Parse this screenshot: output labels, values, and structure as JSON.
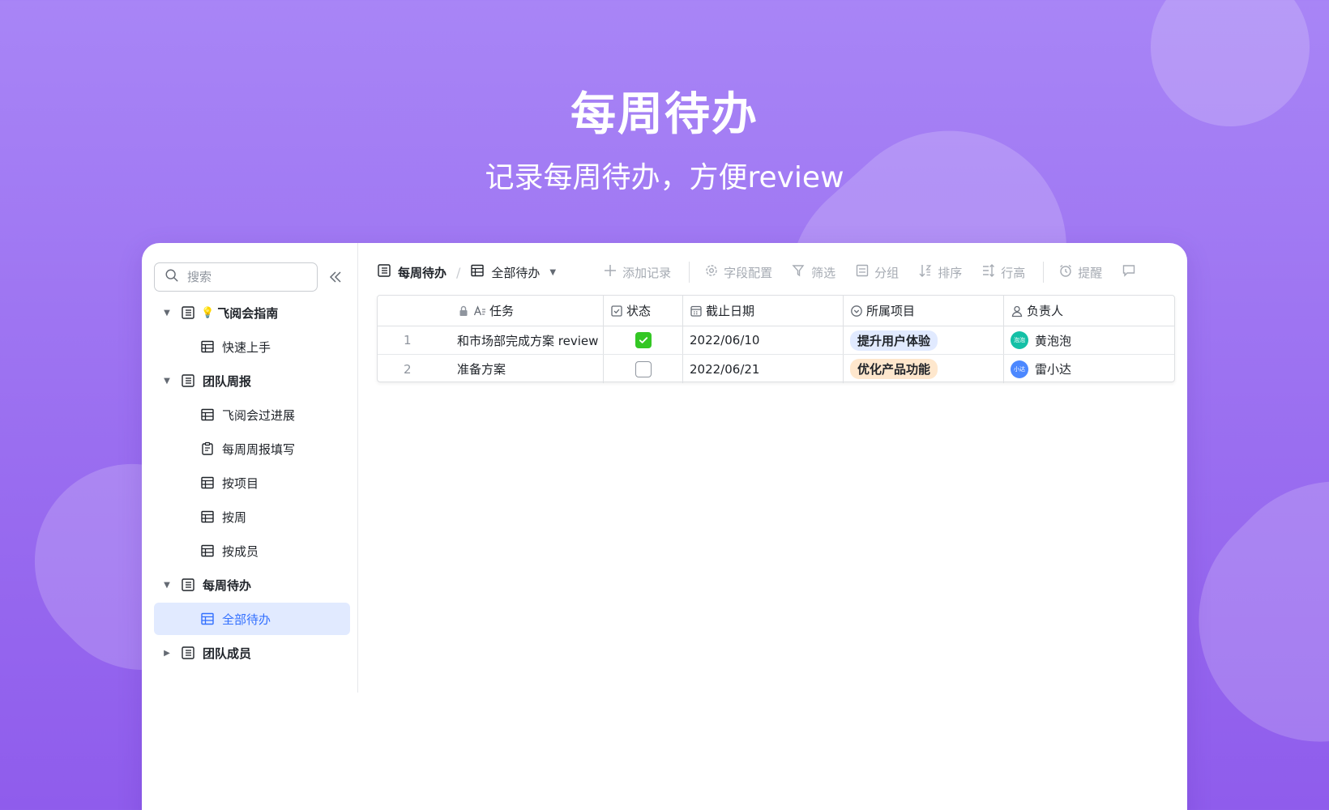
{
  "hero": {
    "title": "每周待办",
    "subtitle": "记录每周待办，方便review"
  },
  "sidebar": {
    "search_placeholder": "搜索",
    "items": [
      {
        "label": "飞阅会指南",
        "level": 0,
        "icon": "doc-icon",
        "expanded": true
      },
      {
        "label": "快速上手",
        "level": 1,
        "icon": "table-icon"
      },
      {
        "label": "团队周报",
        "level": 0,
        "icon": "doc-icon",
        "expanded": true
      },
      {
        "label": "飞阅会过进展",
        "level": 1,
        "icon": "table-icon"
      },
      {
        "label": "每周周报填写",
        "level": 1,
        "icon": "form-icon"
      },
      {
        "label": "按项目",
        "level": 1,
        "icon": "table-icon"
      },
      {
        "label": "按周",
        "level": 1,
        "icon": "table-icon"
      },
      {
        "label": "按成员",
        "level": 1,
        "icon": "table-icon"
      },
      {
        "label": "每周待办",
        "level": 0,
        "icon": "doc-icon",
        "expanded": true
      },
      {
        "label": "全部待办",
        "level": 1,
        "icon": "table-icon",
        "active": true
      },
      {
        "label": "团队成员",
        "level": 0,
        "icon": "doc-icon",
        "expanded": false
      }
    ]
  },
  "toolbar": {
    "table_name": "每周待办",
    "view_name": "全部待办",
    "actions": {
      "add_record": "添加记录",
      "field_config": "字段配置",
      "filter": "筛选",
      "group": "分组",
      "sort": "排序",
      "row_height": "行高",
      "reminder": "提醒"
    }
  },
  "grid": {
    "columns": {
      "task": "任务",
      "status": "状态",
      "due_date": "截止日期",
      "project": "所属项目",
      "owner": "负责人"
    },
    "rows": [
      {
        "index": "1",
        "task": "和市场部完成方案 review",
        "status_done": true,
        "due_date": "2022/06/10",
        "project": "提升用户体验",
        "owner": "黄泡泡",
        "avatar_text": "泡泡"
      },
      {
        "index": "2",
        "task": "准备方案",
        "status_done": false,
        "due_date": "2022/06/21",
        "project": "优化产品功能",
        "owner": "雷小达",
        "avatar_text": "小达"
      }
    ]
  },
  "colors": {
    "accent": "#3370ff",
    "check_green": "#34c724",
    "tag1_bg": "#e1eaff",
    "tag1_text": "#1f2329",
    "tag2_bg": "#fee7cd",
    "tag2_text": "#1f2329",
    "avatar1": "#14c0a6",
    "avatar2": "#4c88ff"
  }
}
